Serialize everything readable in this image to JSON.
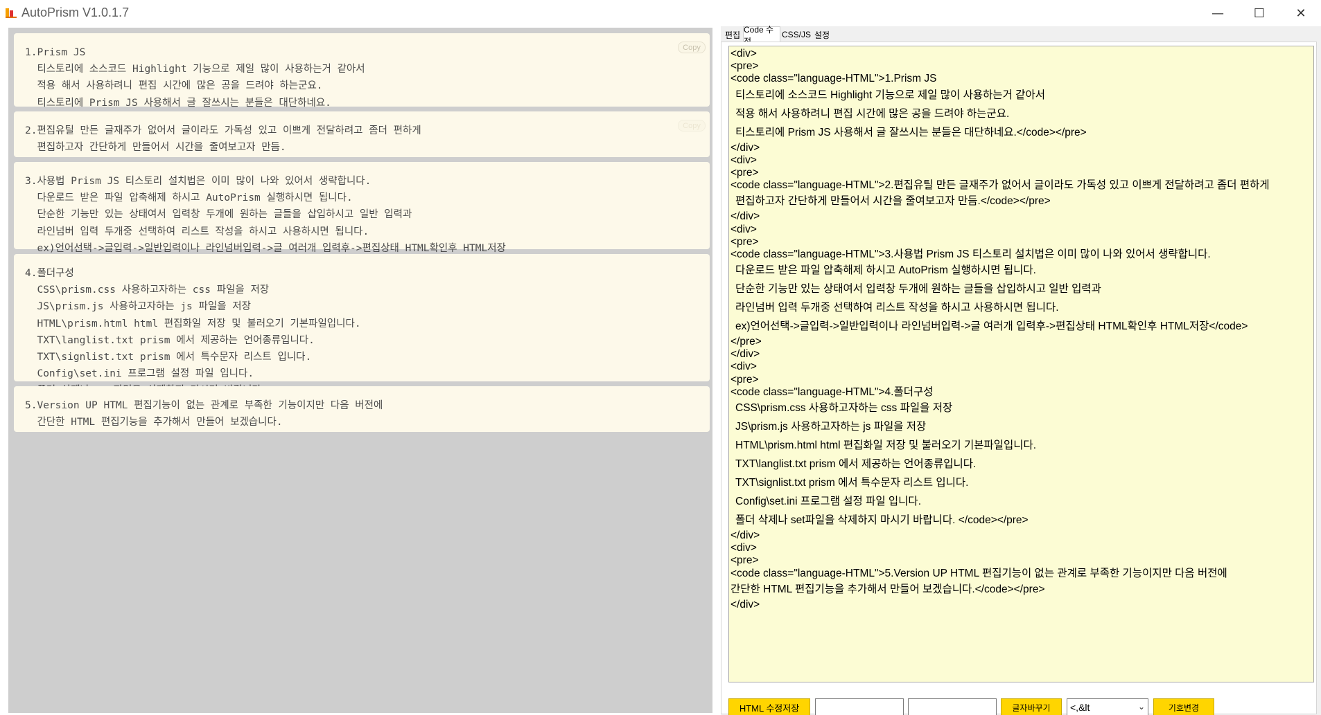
{
  "window": {
    "title": "AutoPrism V1.0.1.7",
    "minimize": "—",
    "maximize": "☐",
    "close": "✕"
  },
  "cards": [
    {
      "copy_label": "Copy",
      "lines": [
        "1.Prism JS",
        "  티스토리에 소스코드 Highlight 기능으로 제일 많이 사용하는거 같아서",
        "  적용 해서 사용하려니 편집 시간에 많은 공을 드려야 하는군요.",
        "  티스토리에 Prism JS 사용해서 글 잘쓰시는 분들은 대단하네요."
      ]
    },
    {
      "copy_label": "Copy",
      "lines": [
        "2.편집유틸 만든 글재주가 없어서 글이라도 가독성 있고 이쁘게 전달하려고 좀더 편하게",
        "  편집하고자 간단하게 만들어서 시간을 줄여보고자 만듬."
      ]
    },
    {
      "copy_label": "",
      "lines": [
        "3.사용법 Prism JS 티스토리 설치법은 이미 많이 나와 있어서 생략합니다.",
        "  다운로드 받은 파일 압축해제 하시고 AutoPrism 실행하시면 됩니다.",
        "  단순한 기능만 있는 상태여서 입력창 두개에 원하는 글들을 삽입하시고 일반 입력과",
        "  라인넘버 입력 두개중 선택하여 리스트 작성을 하시고 사용하시면 됩니다.",
        "  ex)언어선택->글입력->일반입력이나 라인넘버입력->글 여러개 입력후->편집상태 HTML확인후 HTML저장"
      ]
    },
    {
      "copy_label": "",
      "lines": [
        "4.폴더구성",
        "  CSS\\prism.css 사용하고자하는 css 파일을 저장",
        "  JS\\prism.js 사용하고자하는 js 파일을 저장",
        "  HTML\\prism.html html 편집화일 저장 및 불러오기 기본파일입니다.",
        "  TXT\\langlist.txt prism 에서 제공하는 언어종류입니다.",
        "  TXT\\signlist.txt prism 에서 특수문자 리스트 입니다.",
        "  Config\\set.ini 프로그램 설정 파일 입니다.",
        "  폴더 삭제나 set파일을 삭제하지 마시기 바랍니다."
      ]
    },
    {
      "copy_label": "",
      "lines": [
        "5.Version UP HTML 편집기능이 없는 관계로 부족한 기능이지만 다음 버전에",
        "  간단한 HTML 편집기능을 추가해서 만들어 보겠습니다."
      ]
    }
  ],
  "tabs": [
    {
      "label": "편집",
      "active": false
    },
    {
      "label": "Code 수정",
      "active": true
    },
    {
      "label": "CSS/JS",
      "active": false
    },
    {
      "label": "설정",
      "active": false
    }
  ],
  "code_lines": [
    {
      "t": "<div>",
      "k": "short",
      "i": false
    },
    {
      "t": "<pre>",
      "k": "short",
      "i": false
    },
    {
      "t": "<code class=\"language-HTML\">1.Prism JS",
      "k": "short",
      "i": false
    },
    {
      "t": "티스토리에 소스코드 Highlight 기능으로 제일 많이 사용하는거 같아서",
      "k": "tall",
      "i": true
    },
    {
      "t": "적용 해서 사용하려니 편집 시간에 많은 공을 드려야 하는군요.",
      "k": "tall",
      "i": true
    },
    {
      "t": "티스토리에 Prism JS 사용해서 글 잘쓰시는 분들은 대단하네요.</code></pre>",
      "k": "tall",
      "i": true
    },
    {
      "t": "</div>",
      "k": "short",
      "i": false
    },
    {
      "t": "<div>",
      "k": "short",
      "i": false
    },
    {
      "t": "<pre>",
      "k": "short",
      "i": false
    },
    {
      "t": "<code class=\"language-HTML\">2.편집유틸 만든 글재주가 없어서 글이라도 가독성 있고 이쁘게 전달하려고 좀더 편하게",
      "k": "short",
      "i": false
    },
    {
      "t": "편집하고자 간단하게 만들어서 시간을 줄여보고자 만듬.</code></pre>",
      "k": "tall",
      "i": true
    },
    {
      "t": "</div>",
      "k": "short",
      "i": false
    },
    {
      "t": "<div>",
      "k": "short",
      "i": false
    },
    {
      "t": "<pre>",
      "k": "short",
      "i": false
    },
    {
      "t": "<code class=\"language-HTML\">3.사용법 Prism JS 티스토리 설치법은 이미 많이 나와 있어서 생략합니다.",
      "k": "short",
      "i": false
    },
    {
      "t": "다운로드 받은 파일 압축해제 하시고 AutoPrism 실행하시면 됩니다.",
      "k": "tall",
      "i": true
    },
    {
      "t": "단순한 기능만 있는 상태여서 입력창 두개에 원하는 글들을 삽입하시고 일반 입력과",
      "k": "tall",
      "i": true
    },
    {
      "t": "라인넘버 입력 두개중 선택하여 리스트 작성을 하시고 사용하시면 됩니다.",
      "k": "tall",
      "i": true
    },
    {
      "t": "ex)언어선택->글입력->일반입력이나 라인넘버입력->글 여러개 입력후->편집상태 HTML확인후 HTML저장</code>",
      "k": "tall",
      "i": true
    },
    {
      "t": "</pre>",
      "k": "short",
      "i": false
    },
    {
      "t": "</div>",
      "k": "short",
      "i": false
    },
    {
      "t": "<div>",
      "k": "short",
      "i": false
    },
    {
      "t": "<pre>",
      "k": "short",
      "i": false
    },
    {
      "t": "<code class=\"language-HTML\">4.폴더구성",
      "k": "short",
      "i": false
    },
    {
      "t": "CSS\\prism.css 사용하고자하는 css 파일을 저장",
      "k": "tall",
      "i": true
    },
    {
      "t": "JS\\prism.js 사용하고자하는 js 파일을 저장",
      "k": "tall",
      "i": true
    },
    {
      "t": "HTML\\prism.html html 편집화일 저장 및 불러오기 기본파일입니다.",
      "k": "tall",
      "i": true
    },
    {
      "t": "TXT\\langlist.txt prism 에서 제공하는 언어종류입니다.",
      "k": "tall",
      "i": true
    },
    {
      "t": "TXT\\signlist.txt prism 에서 특수문자 리스트 입니다.",
      "k": "tall",
      "i": true
    },
    {
      "t": "Config\\set.ini 프로그램 설정 파일 입니다.",
      "k": "tall",
      "i": true
    },
    {
      "t": "폴더 삭제나 set파일을 삭제하지 마시기 바랍니다. </code></pre>",
      "k": "tall",
      "i": true
    },
    {
      "t": "</div>",
      "k": "short",
      "i": false
    },
    {
      "t": "<div>",
      "k": "short",
      "i": false
    },
    {
      "t": "<pre>",
      "k": "short",
      "i": false
    },
    {
      "t": "<code class=\"language-HTML\">5.Version UP HTML 편집기능이 없는 관계로 부족한 기능이지만 다음 버전에",
      "k": "short",
      "i": false
    },
    {
      "t": "간단한 HTML 편집기능을 추가해서 만들어 보겠습니다.</code></pre>",
      "k": "tall",
      "i": false
    },
    {
      "t": "</div>",
      "k": "short",
      "i": false
    }
  ],
  "toolbar": {
    "save_label": "HTML 수정저장",
    "find_value": "",
    "replace_value": "",
    "replace_label": "글자바꾸기",
    "symbol_selected": "<,&lt",
    "symbol_change_label": "기호변경"
  },
  "colors": {
    "accent_yellow": "#ffd500",
    "editor_bg": "#fcfcd4",
    "card_bg": "#fdf9ea",
    "left_bg": "#cecece"
  }
}
